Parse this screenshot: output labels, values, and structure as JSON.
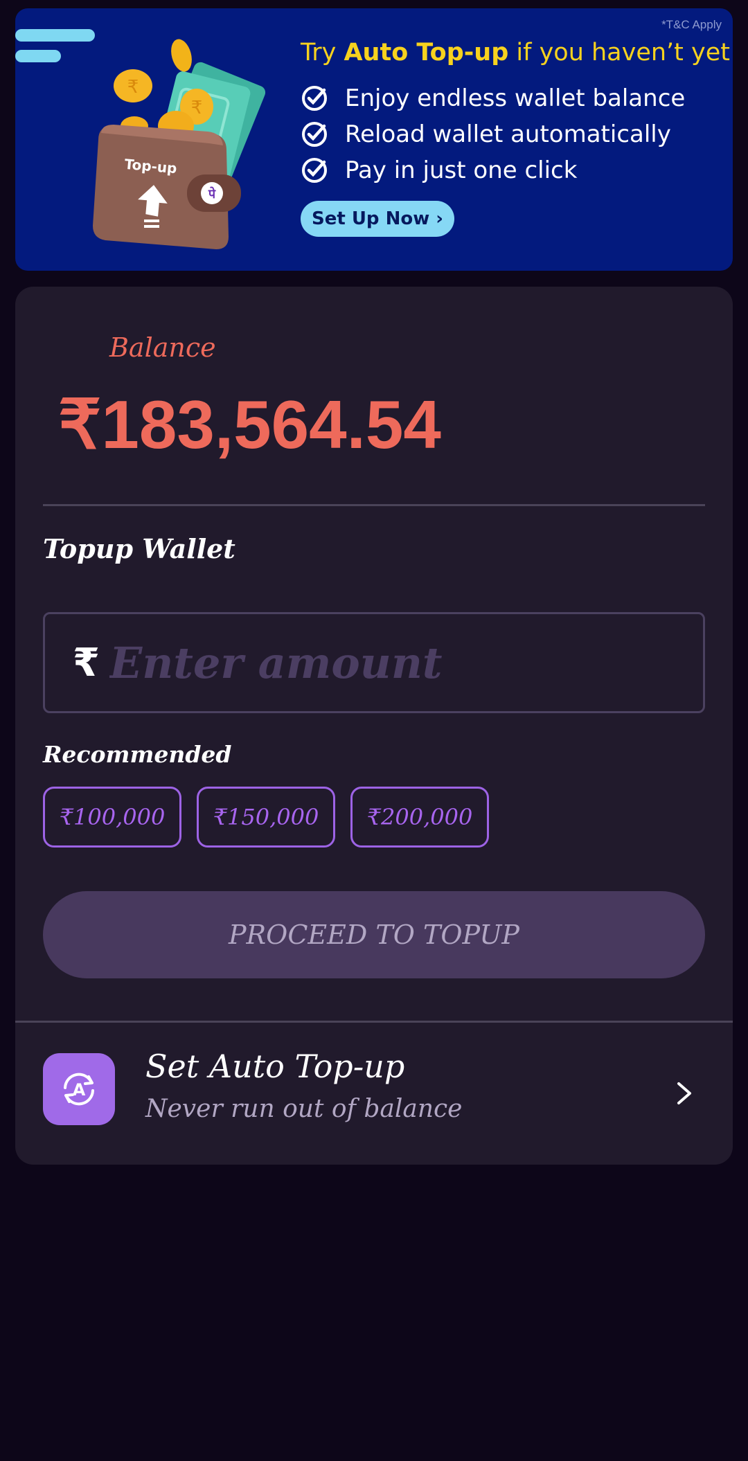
{
  "banner": {
    "tc": "*T&C Apply",
    "title_prefix": "Try ",
    "title_bold": "Auto Top-up",
    "title_suffix": " if you haven’t yet!",
    "benefits": [
      "Enjoy endless wallet balance",
      "Reload wallet automatically",
      "Pay in just one click"
    ],
    "cta": "Set Up Now ›",
    "wallet_label": "Top-up",
    "wallet_badge": "पे"
  },
  "balance": {
    "label": "Balance",
    "amount": "₹183,564.54"
  },
  "topup": {
    "title": "Topup Wallet",
    "currency_symbol": "₹",
    "placeholder": "Enter amount",
    "recommended_title": "Recommended",
    "recommended": [
      "₹100,000",
      "₹150,000",
      "₹200,000"
    ],
    "proceed_label": "PROCEED TO TOPUP"
  },
  "auto_topup": {
    "title": "Set Auto Top-up",
    "subtitle": "Never run out of balance",
    "icon_letter": "A"
  },
  "colors": {
    "banner_bg": "#031a7e",
    "banner_title": "#f7d21e",
    "balance": "#ee6a5b",
    "accent": "#a06ae8",
    "card_bg": "#211a2c",
    "page_bg": "#0d0619"
  }
}
